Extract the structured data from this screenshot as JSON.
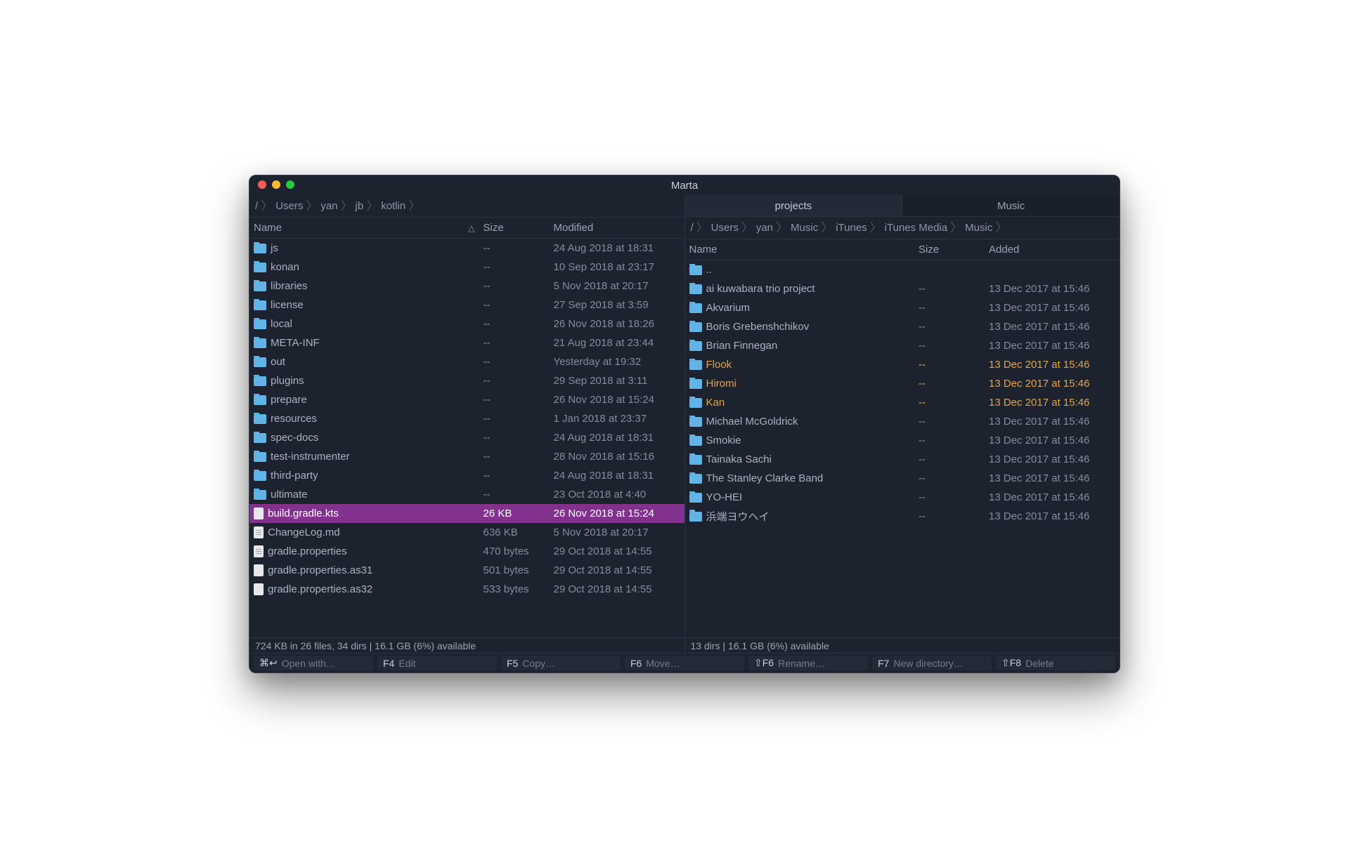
{
  "title": "Marta",
  "left": {
    "breadcrumb": [
      "/",
      "Users",
      "yan",
      "jb",
      "kotlin"
    ],
    "headers": {
      "name": "Name",
      "size": "Size",
      "date": "Modified"
    },
    "status": "724 KB in 26 files, 34 dirs  |  16.1 GB (6%) available",
    "rows": [
      {
        "type": "folder",
        "name": "js",
        "size": "--",
        "date": "24 Aug 2018 at 18:31"
      },
      {
        "type": "folder",
        "name": "konan",
        "size": "--",
        "date": "10 Sep 2018 at 23:17"
      },
      {
        "type": "folder",
        "name": "libraries",
        "size": "--",
        "date": "5 Nov 2018 at 20:17"
      },
      {
        "type": "folder",
        "name": "license",
        "size": "--",
        "date": "27 Sep 2018 at 3:59"
      },
      {
        "type": "folder",
        "name": "local",
        "size": "--",
        "date": "26 Nov 2018 at 18:26"
      },
      {
        "type": "folder",
        "name": "META-INF",
        "size": "--",
        "date": "21 Aug 2018 at 23:44"
      },
      {
        "type": "folder",
        "name": "out",
        "size": "--",
        "date": "Yesterday at 19:32"
      },
      {
        "type": "folder",
        "name": "plugins",
        "size": "--",
        "date": "29 Sep 2018 at 3:11"
      },
      {
        "type": "folder",
        "name": "prepare",
        "size": "--",
        "date": "26 Nov 2018 at 15:24"
      },
      {
        "type": "folder",
        "name": "resources",
        "size": "--",
        "date": "1 Jan 2018 at 23:37"
      },
      {
        "type": "folder",
        "name": "spec-docs",
        "size": "--",
        "date": "24 Aug 2018 at 18:31"
      },
      {
        "type": "folder",
        "name": "test-instrumenter",
        "size": "--",
        "date": "28 Nov 2018 at 15:16"
      },
      {
        "type": "folder",
        "name": "third-party",
        "size": "--",
        "date": "24 Aug 2018 at 18:31"
      },
      {
        "type": "folder",
        "name": "ultimate",
        "size": "--",
        "date": "23 Oct 2018 at 4:40"
      },
      {
        "type": "file",
        "name": "build.gradle.kts",
        "size": "26 KB",
        "date": "26 Nov 2018 at 15:24",
        "selected": true,
        "blank": true
      },
      {
        "type": "file",
        "name": "ChangeLog.md",
        "size": "636 KB",
        "date": "5 Nov 2018 at 20:17"
      },
      {
        "type": "file",
        "name": "gradle.properties",
        "size": "470 bytes",
        "date": "29 Oct 2018 at 14:55"
      },
      {
        "type": "file",
        "name": "gradle.properties.as31",
        "size": "501 bytes",
        "date": "29 Oct 2018 at 14:55",
        "blank": true
      },
      {
        "type": "file",
        "name": "gradle.properties.as32",
        "size": "533 bytes",
        "date": "29 Oct 2018 at 14:55",
        "blank": true
      }
    ]
  },
  "right": {
    "tabs": [
      {
        "label": "projects",
        "active": true
      },
      {
        "label": "Music",
        "active": false
      }
    ],
    "breadcrumb": [
      "/",
      "Users",
      "yan",
      "Music",
      "iTunes",
      "iTunes Media",
      "Music"
    ],
    "headers": {
      "name": "Name",
      "size": "Size",
      "date": "Added"
    },
    "status": "13 dirs  |  16.1 GB (6%) available",
    "rows": [
      {
        "type": "folder",
        "name": "..",
        "size": "",
        "date": ""
      },
      {
        "type": "folder",
        "name": "ai kuwabara trio project",
        "size": "--",
        "date": "13 Dec 2017 at 15:46"
      },
      {
        "type": "folder",
        "name": "Akvarium",
        "size": "--",
        "date": "13 Dec 2017 at 15:46"
      },
      {
        "type": "folder",
        "name": "Boris Grebenshchikov",
        "size": "--",
        "date": "13 Dec 2017 at 15:46"
      },
      {
        "type": "folder",
        "name": "Brian Finnegan",
        "size": "--",
        "date": "13 Dec 2017 at 15:46"
      },
      {
        "type": "folder",
        "name": "Flook",
        "size": "--",
        "date": "13 Dec 2017 at 15:46",
        "marked": true
      },
      {
        "type": "folder",
        "name": "Hiromi",
        "size": "--",
        "date": "13 Dec 2017 at 15:46",
        "marked": true
      },
      {
        "type": "folder",
        "name": "Kan",
        "size": "--",
        "date": "13 Dec 2017 at 15:46",
        "marked": true
      },
      {
        "type": "folder",
        "name": "Michael McGoldrick",
        "size": "--",
        "date": "13 Dec 2017 at 15:46"
      },
      {
        "type": "folder",
        "name": "Smokie",
        "size": "--",
        "date": "13 Dec 2017 at 15:46"
      },
      {
        "type": "folder",
        "name": "Tainaka Sachi",
        "size": "--",
        "date": "13 Dec 2017 at 15:46"
      },
      {
        "type": "folder",
        "name": "The Stanley Clarke Band",
        "size": "--",
        "date": "13 Dec 2017 at 15:46"
      },
      {
        "type": "folder",
        "name": "YO-HEI",
        "size": "--",
        "date": "13 Dec 2017 at 15:46"
      },
      {
        "type": "folder",
        "name": "浜端ヨウヘイ",
        "size": "--",
        "date": "13 Dec 2017 at 15:46"
      }
    ]
  },
  "fkeys": [
    {
      "key": "⌘↩",
      "label": "Open with…"
    },
    {
      "key": "F4",
      "label": "Edit"
    },
    {
      "key": "F5",
      "label": "Copy…"
    },
    {
      "key": "F6",
      "label": "Move…"
    },
    {
      "key": "⇧F6",
      "label": "Rename…"
    },
    {
      "key": "F7",
      "label": "New directory…"
    },
    {
      "key": "⇧F8",
      "label": "Delete"
    }
  ]
}
